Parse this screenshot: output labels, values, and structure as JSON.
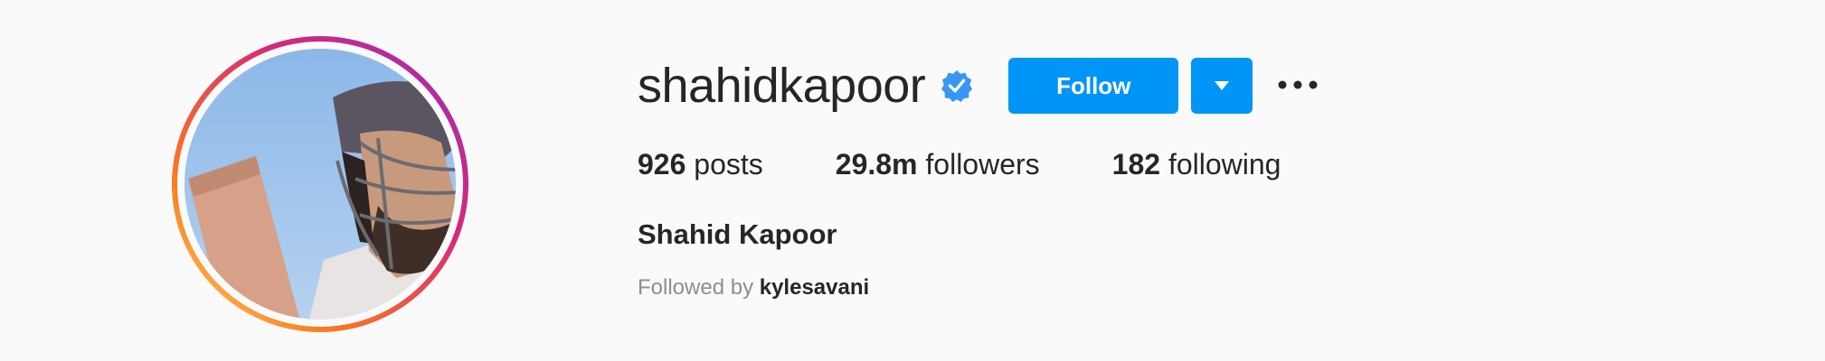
{
  "profile": {
    "username": "shahidkapoor",
    "verified_icon": "verified-badge-icon",
    "full_name": "Shahid Kapoor",
    "avatar_icon": "profile-photo"
  },
  "actions": {
    "follow_label": "Follow",
    "dropdown_icon": "caret-down-icon",
    "more_icon": "more-options-icon"
  },
  "stats": [
    {
      "count": "926",
      "label": "posts"
    },
    {
      "count": "29.8m",
      "label": "followers"
    },
    {
      "count": "182",
      "label": "following"
    }
  ],
  "followed_by": {
    "prefix": "Followed by",
    "user": "kylesavani"
  },
  "colors": {
    "accent": "#0095f6",
    "background": "#fafafa",
    "text": "#262626",
    "muted": "#8e8e8e",
    "story_ring_start": "#d62976",
    "story_ring_end": "#fa7e1e"
  }
}
